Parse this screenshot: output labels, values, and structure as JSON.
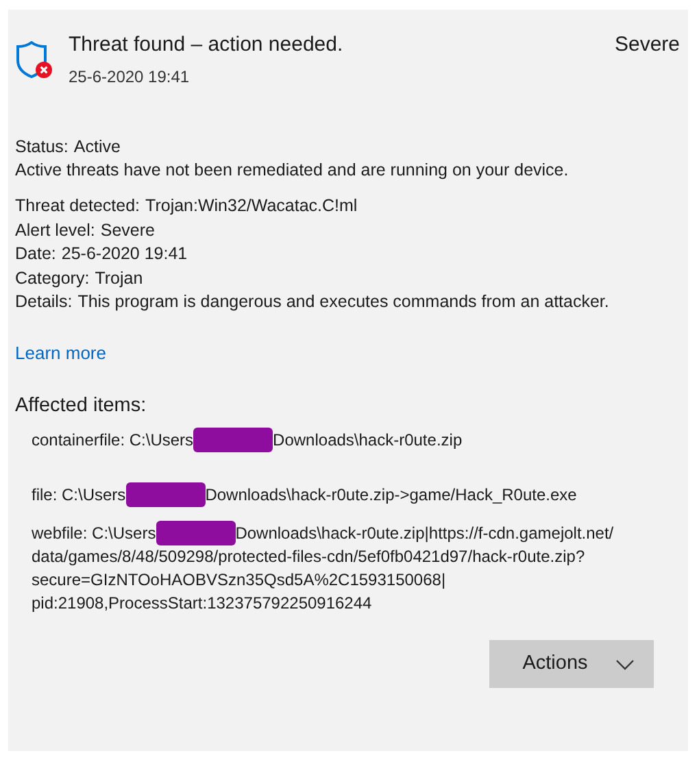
{
  "header": {
    "title": "Threat found – action needed.",
    "date": "25-6-2020 19:41",
    "severity": "Severe"
  },
  "status": {
    "label": "Status:",
    "value": "Active",
    "description": "Active threats have not been remediated and are running on your device."
  },
  "details": [
    {
      "label": "Threat detected:",
      "value": "Trojan:Win32/Wacatac.C!ml"
    },
    {
      "label": "Alert level:",
      "value": "Severe"
    },
    {
      "label": "Date:",
      "value": "25-6-2020 19:41"
    },
    {
      "label": "Category:",
      "value": "Trojan"
    },
    {
      "label": "Details:",
      "value": "This program is dangerous and executes commands from an attacker."
    }
  ],
  "learn_more": "Learn more",
  "affected": {
    "heading": "Affected items:",
    "items": [
      {
        "before": "containerfile: C:\\Users",
        "after": "Downloads\\hack-r0ute.zip"
      },
      {
        "before": "file: C:\\Users",
        "after": "Downloads\\hack-r0ute.zip->game/Hack_R0ute.exe"
      },
      {
        "before": "webfile: C:\\Users",
        "after": "Downloads\\hack-r0ute.zip|https://f-cdn.gamejolt.net/",
        "continued": [
          "data/games/8/48/509298/protected-files-cdn/5ef0fb0421d97/hack-r0ute.zip?",
          "secure=GIzNTOoHAOBVSzn35Qsd5A%2C1593150068|",
          "pid:21908,ProcessStart:132375792250916244"
        ]
      }
    ]
  },
  "actions_button": "Actions"
}
